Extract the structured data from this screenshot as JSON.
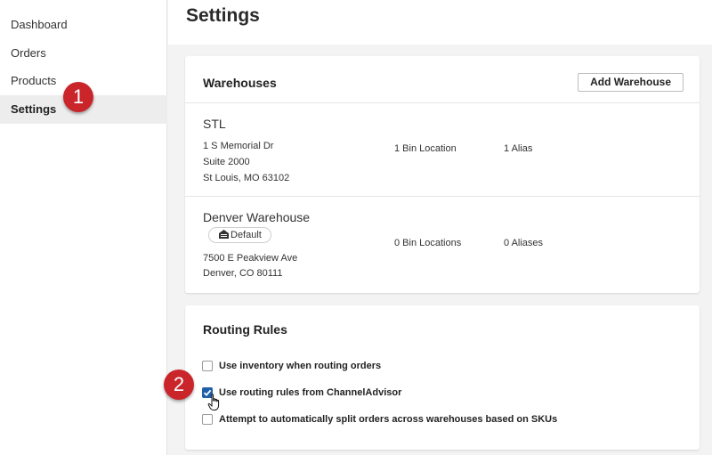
{
  "sidebar": {
    "items": [
      {
        "label": "Dashboard"
      },
      {
        "label": "Orders"
      },
      {
        "label": "Products"
      },
      {
        "label": "Settings",
        "active": true
      }
    ]
  },
  "header": {
    "title": "Settings"
  },
  "warehouses": {
    "title": "Warehouses",
    "add_button": "Add Warehouse",
    "items": [
      {
        "name": "STL",
        "address": [
          "1 S Memorial Dr",
          "Suite 2000",
          "St Louis, MO 63102"
        ],
        "bins": "1 Bin Location",
        "aliases": "1 Alias"
      },
      {
        "name": "Denver Warehouse",
        "badge": "Default",
        "address": [
          "7500 E Peakview Ave",
          "Denver, CO 80111"
        ],
        "bins": "0 Bin Locations",
        "aliases": "0 Aliases"
      }
    ]
  },
  "routing": {
    "title": "Routing Rules",
    "rules": [
      {
        "label": "Use inventory when routing orders",
        "checked": false
      },
      {
        "label": "Use routing rules from ChannelAdvisor",
        "checked": true
      },
      {
        "label": "Attempt to automatically split orders across warehouses based on SKUs",
        "checked": false
      }
    ]
  },
  "annotations": [
    "1",
    "2"
  ],
  "colors": {
    "accent": "#1f5fa8",
    "marker": "#c9252b"
  }
}
